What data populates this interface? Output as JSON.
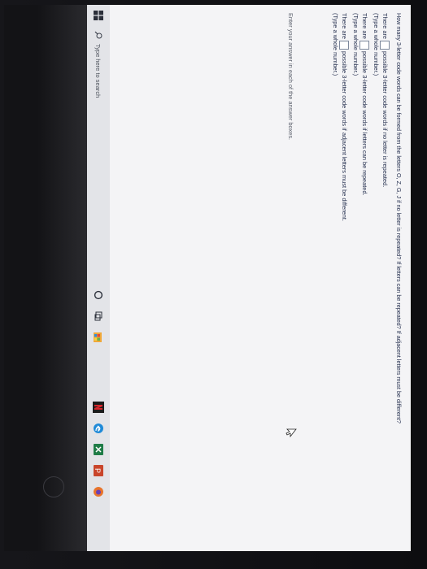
{
  "question": {
    "text": "How many 3-letter code words can be formed from the letters O, Z, G, J if no letter is repeated? If letters can be repeated? If adjacent letters must be different?"
  },
  "answers": [
    {
      "prefix": "There are",
      "suffix": "possible 3-letter code words if no letter is repeated.",
      "hint": "(Type a whole number.)"
    },
    {
      "prefix": "There are",
      "suffix": "possible 3-letter code words if letters can be repeated.",
      "hint": "(Type a whole number.)"
    },
    {
      "prefix": "There are",
      "suffix": "possible 3-letter code words if adjacent letters must be different.",
      "hint": "(Type a whole number.)"
    }
  ],
  "instructions": "Enter your answer in each of the answer boxes.",
  "taskbar": {
    "search_placeholder": "Type here to search"
  },
  "icons": {
    "start": "windows-icon",
    "search": "search-icon",
    "cortana": "cortana-icon",
    "task_view": "task-view-icon",
    "store": "store-icon",
    "netflix": "netflix-icon",
    "edge": "edge-icon",
    "excel": "excel-icon",
    "powerpoint": "powerpoint-icon",
    "firefox": "firefox-icon"
  },
  "colors": {
    "text": "#1f2a4a",
    "netflix": "#d7262b",
    "excel": "#1f7c47",
    "powerpoint": "#c9452b",
    "edge": "#1f8ad8"
  }
}
